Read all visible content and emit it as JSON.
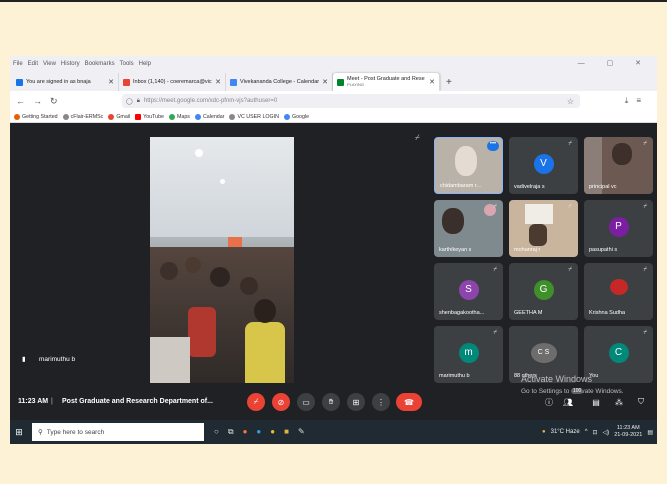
{
  "browser": {
    "menu": [
      "File",
      "Edit",
      "View",
      "History",
      "Bookmarks",
      "Tools",
      "Help"
    ],
    "tabs": [
      {
        "title": "You are signed in as bnaja",
        "fav_color": "#1a73e8"
      },
      {
        "title": "Inbox (1,140) - coeremarca@vic",
        "fav_color": "#ea4335"
      },
      {
        "title": "Vivekananda College - Calendar",
        "fav_color": "#4285f4"
      },
      {
        "title": "Meet - Post Graduate and Rese",
        "subtitle": "PLAYING",
        "fav_color": "#00832d"
      }
    ],
    "new_tab": "+",
    "url": "https://meet.google.com/xdc-pfnm-vjs?authuser=0",
    "bookmarks": [
      {
        "label": "Getting Started",
        "color": "#e66000"
      },
      {
        "label": "cFlair-ERMSc",
        "color": "#555"
      },
      {
        "label": "Gmail",
        "color": "#ea4335"
      },
      {
        "label": "YouTube",
        "color": "#ff0000"
      },
      {
        "label": "Maps",
        "color": "#34a853"
      },
      {
        "label": "Calendar",
        "color": "#4285f4"
      },
      {
        "label": "VC USER LOGIN",
        "color": "#555"
      },
      {
        "label": "Google",
        "color": "#4285f4"
      }
    ]
  },
  "meet": {
    "main_label": "marimuthu b",
    "time": "11:23 AM",
    "meeting_title": "Post Graduate and Research Department of...",
    "participants": [
      {
        "name": "chidambaram r...",
        "type": "video",
        "active": true,
        "more": "•••"
      },
      {
        "name": "vadivelraja s",
        "avatar": "V",
        "color": "#1a73e8"
      },
      {
        "name": "principal vc",
        "type": "video"
      },
      {
        "name": "karthikeyan s",
        "type": "video"
      },
      {
        "name": "mohanraj r",
        "type": "video"
      },
      {
        "name": "pasupathi s",
        "avatar": "P",
        "color": "#7b1fa2"
      },
      {
        "name": "shenbagakootha...",
        "avatar": "S",
        "color": "#8e44ad"
      },
      {
        "name": "GEETHA M",
        "avatar": "G",
        "color": "#3f8f2a"
      },
      {
        "name": "Krishna Sudha",
        "type": "image"
      },
      {
        "name": "marimuthu b",
        "avatar": "m",
        "color": "#00897b"
      },
      {
        "name": "88 others",
        "avatar": "C S",
        "color": "#6d6d6d"
      },
      {
        "name": "You",
        "avatar": "C",
        "color": "#00897b"
      }
    ],
    "participant_count": "100",
    "activate_title": "Activate Windows",
    "activate_sub": "Go to Settings to activate Windows."
  },
  "taskbar": {
    "search_placeholder": "Type here to search",
    "weather": "31°C  Haze",
    "time": "11:23 AM",
    "date": "21-09-2021"
  }
}
